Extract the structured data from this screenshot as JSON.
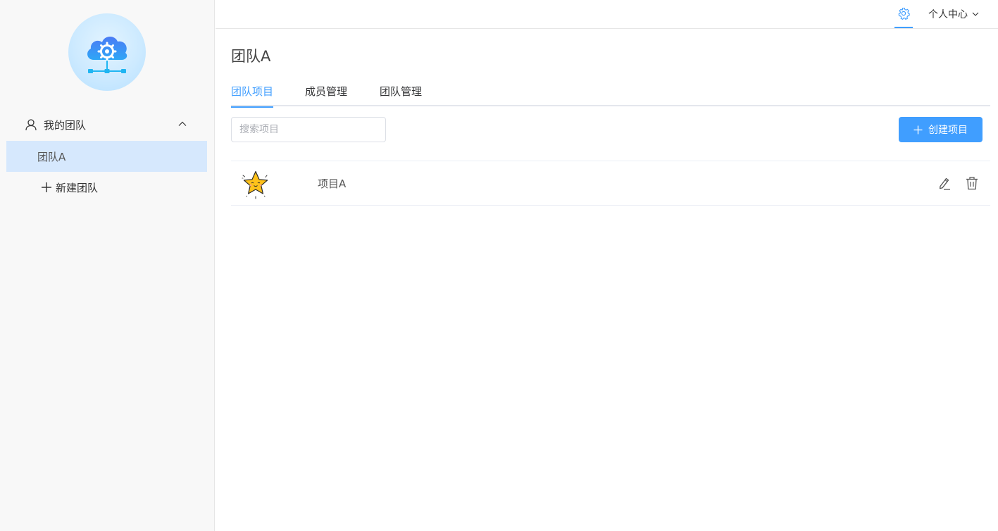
{
  "sidebar": {
    "logo_icon": "cloud-gear-network-icon",
    "group": {
      "label": "我的团队",
      "icon": "user-icon",
      "expanded": true,
      "items": [
        {
          "label": "团队A",
          "active": true
        }
      ],
      "new_label": "新建团队"
    }
  },
  "topbar": {
    "settings_icon": "gear-icon",
    "user_menu_label": "个人中心"
  },
  "main": {
    "title": "团队A",
    "tabs": [
      {
        "label": "团队项目",
        "active": true
      },
      {
        "label": "成员管理",
        "active": false
      },
      {
        "label": "团队管理",
        "active": false
      }
    ],
    "search": {
      "placeholder": "搜索项目",
      "value": ""
    },
    "create_button_label": "创建项目",
    "projects": [
      {
        "name": "项目A",
        "avatar": "star-sticker-icon"
      }
    ]
  },
  "colors": {
    "accent": "#409eff",
    "sidebar_bg": "#f8f8f8",
    "active_item_bg": "#d6e8fd"
  }
}
